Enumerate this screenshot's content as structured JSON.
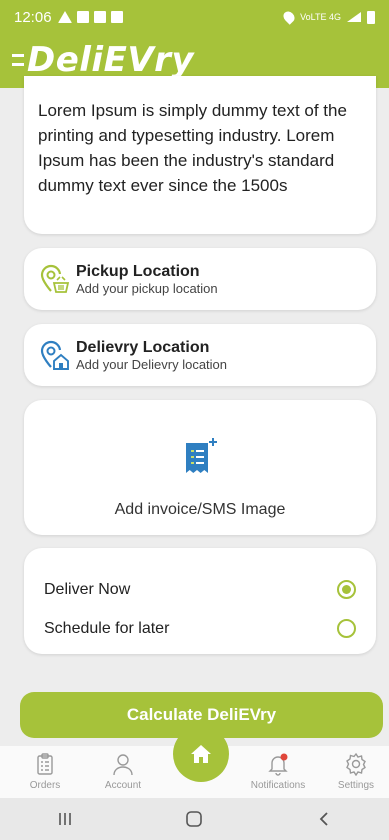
{
  "status_bar": {
    "time": "12:06",
    "network_label": "VoLTE 4G"
  },
  "app": {
    "logo_text": "DeliEVry"
  },
  "description": {
    "text": "Lorem Ipsum is simply dummy text of the printing and typesetting industry. Lorem Ipsum has been the industry's standard dummy text ever since the 1500s"
  },
  "pickup": {
    "title": "Pickup Location",
    "subtitle": "Add your pickup location"
  },
  "delivery": {
    "title": "Delievry Location",
    "subtitle": "Add your Delievry location"
  },
  "invoice": {
    "label": "Add invoice/SMS Image"
  },
  "schedule": {
    "options": [
      {
        "label": "Deliver Now",
        "selected": true
      },
      {
        "label": "Schedule for later",
        "selected": false
      }
    ]
  },
  "calculate_button": {
    "label": "Calculate DeliEVry"
  },
  "bottom_nav": {
    "items": [
      {
        "label": "Orders",
        "icon": "clipboard-icon"
      },
      {
        "label": "Account",
        "icon": "person-icon"
      },
      {
        "label": "",
        "icon": "home-icon"
      },
      {
        "label": "Notifications",
        "icon": "bell-icon"
      },
      {
        "label": "Settings",
        "icon": "gear-icon"
      }
    ]
  },
  "colors": {
    "brand": "#a6c23a",
    "location_icon_green": "#a6c23a",
    "location_icon_blue": "#2f7fc1",
    "invoice_icon_blue": "#2f7fc1",
    "notification_dot": "#e0463a"
  }
}
